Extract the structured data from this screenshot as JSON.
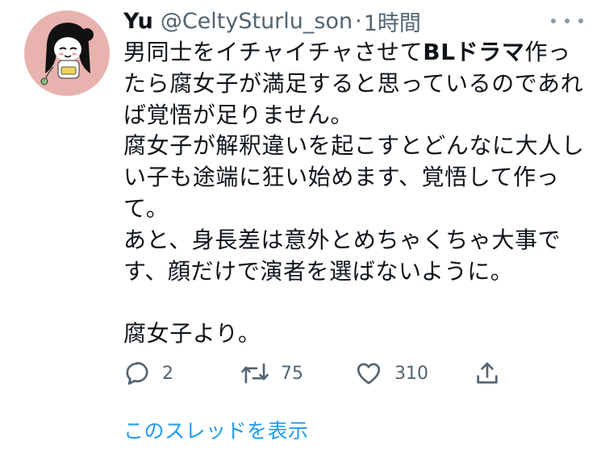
{
  "tweet": {
    "display_name": "Yu",
    "handle": "@CeltySturlu_son",
    "separator": "·",
    "time": "1時間",
    "body_lines": [
      {
        "pre": "男同士をイチャイチャさせて",
        "bold": "BLドラマ",
        "post": "作っ"
      },
      {
        "text": "たら腐女子が満足すると思っているのであれ"
      },
      {
        "text": "ば覚悟が足りません。"
      },
      {
        "text": "腐女子が解釈違いを起こすとどんなに大人し"
      },
      {
        "text": "い子も途端に狂い始めます、覚悟して作っ"
      },
      {
        "text": "て。"
      },
      {
        "text": "あと、身長差は意外とめちゃくちゃ大事で"
      },
      {
        "text": "す、顔だけで演者を選ばないように。"
      },
      {
        "text": ""
      },
      {
        "text": "腐女子より。"
      }
    ]
  },
  "actions": {
    "reply": {
      "icon": "reply-icon",
      "count": "2"
    },
    "retweet": {
      "icon": "retweet-icon",
      "count": "75"
    },
    "like": {
      "icon": "heart-icon",
      "count": "310"
    },
    "share": {
      "icon": "share-icon"
    }
  },
  "thread_link": "このスレッドを表示",
  "colors": {
    "text": "#0f1419",
    "secondary": "#536471",
    "link": "#1d9bf0",
    "avatar_bg": "#e8b3ae"
  }
}
